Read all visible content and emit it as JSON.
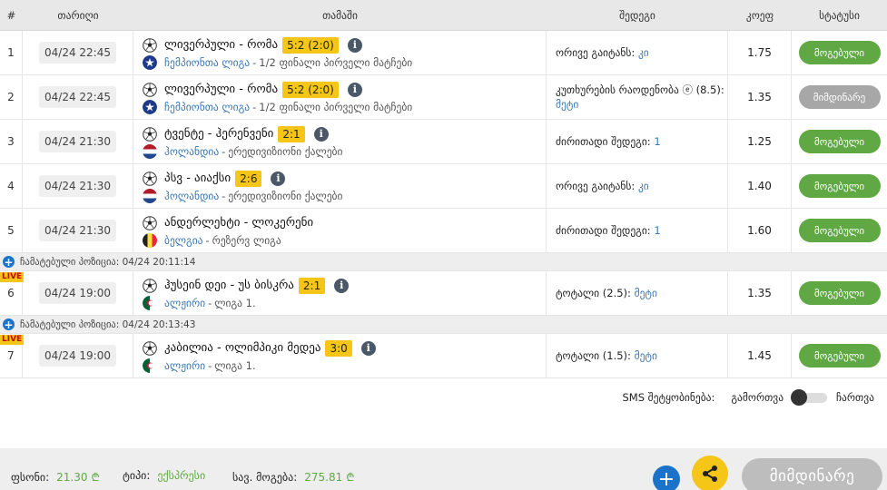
{
  "header": {
    "num": "#",
    "date": "თარიღი",
    "match": "თამაში",
    "result": "შედეგი",
    "odds": "კოეფ",
    "status": "სტატუსი"
  },
  "rows": [
    {
      "num": "1",
      "date": "04/24 22:45",
      "teams": "ლივერპული - რომა",
      "score": "5:2 (2:0)",
      "country": "ჩემპიონთა ლიგა",
      "league": "1/2 ფინალი პირველი მატჩები",
      "result_text": "ორივე გაიტანს:",
      "result_pick": "კი",
      "odds": "1.75",
      "status": "მოგებული"
    },
    {
      "num": "2",
      "date": "04/24 22:45",
      "teams": "ლივერპული - რომა",
      "score": "5:2 (2:0)",
      "country": "ჩემპიონთა ლიგა",
      "league": "1/2 ფინალი პირველი მატჩები",
      "result_text": "კუთხურების რაოდენობა ⓔ (8.5):",
      "result_pick": "მეტი",
      "odds": "1.35",
      "status": "მიმდინარე"
    },
    {
      "num": "3",
      "date": "04/24 21:30",
      "teams": "ტვენტე - ჰერენვენი",
      "score": "2:1",
      "country": "ჰოლანდია",
      "league": "ერედივიზიონი ქალები",
      "result_text": "ძირითადი შედეგი:",
      "result_pick": "1",
      "odds": "1.25",
      "status": "მოგებული"
    },
    {
      "num": "4",
      "date": "04/24 21:30",
      "teams": "პსვ - აიაქსი",
      "score": "2:6",
      "country": "ჰოლანდია",
      "league": "ერედივიზიონი ქალები",
      "result_text": "ორივე გაიტანს:",
      "result_pick": "კი",
      "odds": "1.40",
      "status": "მოგებული"
    },
    {
      "num": "5",
      "date": "04/24 21:30",
      "teams": "ანდერლეხტი - ლოკერენი",
      "score": "",
      "country": "ბელგია",
      "league": "რეზერვ ლიგა",
      "result_text": "ძირითადი შედეგი:",
      "result_pick": "1",
      "odds": "1.60",
      "status": "მოგებული"
    },
    {
      "num": "6",
      "live": "LIVE",
      "date": "04/24 19:00",
      "teams": "ჰუსეინ დეი - უს ბისკრა",
      "score": "2:1",
      "country": "ალჟირი",
      "league": "ლიგა 1.",
      "result_text": "ტოტალი (2.5):",
      "result_pick": "მეტი",
      "odds": "1.35",
      "status": "მოგებული"
    },
    {
      "num": "7",
      "live": "LIVE",
      "date": "04/24 19:00",
      "teams": "კაბილია - ოლიმპიკი მედეა",
      "score": "3:0",
      "country": "ალჟირი",
      "league": "ლიგა 1.",
      "result_text": "ტოტალი (1.5):",
      "result_pick": "მეტი",
      "odds": "1.45",
      "status": "მოგებული"
    }
  ],
  "added": [
    "ჩამატებული პოზიცია: 04/24 20:11:14",
    "ჩამატებული პოზიცია: 04/24 20:13:43"
  ],
  "sms": {
    "label": "SMS შეტყობინება:",
    "off": "გამორთვა",
    "on": "ჩართვა"
  },
  "footer": {
    "stake_label": "ფსონი:",
    "stake_value": "21.30",
    "type_label": "ტიპი:",
    "type_value": "ექსპრესი",
    "win_label": "სავ. მოგება:",
    "win_value": "275.81",
    "currency": "₾",
    "plus": "+",
    "pending_button": "მიმდინარე"
  },
  "colors": {
    "won": "#5fa843",
    "pending": "#a7a7a7",
    "score_bg": "#f5c518",
    "link": "#3a78b3",
    "blue": "#1a73c9"
  },
  "icons": [
    "football-icon",
    "info-icon",
    "champions-league-icon",
    "netherlands-flag-icon",
    "belgium-flag-icon",
    "algeria-flag-icon",
    "plus-icon",
    "share-icon",
    "toggle-switch"
  ]
}
